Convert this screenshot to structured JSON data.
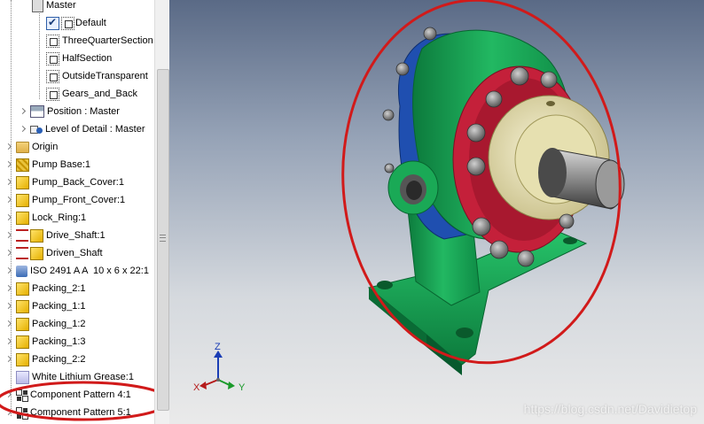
{
  "browser": {
    "items": [
      {
        "label": "Master",
        "icon": "document-icon"
      },
      {
        "label": "Default",
        "icon": "checked-view-icon"
      },
      {
        "label": "ThreeQuarterSection",
        "icon": "view-rep-icon"
      },
      {
        "label": "HalfSection",
        "icon": "view-rep-icon"
      },
      {
        "label": "OutsideTransparent",
        "icon": "view-rep-icon"
      },
      {
        "label": "Gears_and_Back",
        "icon": "view-rep-icon"
      },
      {
        "label": "Position : Master",
        "icon": "position-rep-icon"
      },
      {
        "label": "Level of Detail : Master",
        "icon": "level-of-detail-icon"
      },
      {
        "label": "Origin",
        "icon": "folder-icon"
      },
      {
        "label": "Pump Base:1",
        "icon": "part-icon"
      },
      {
        "label": "Pump_Back_Cover:1",
        "icon": "part-icon"
      },
      {
        "label": "Pump_Front_Cover:1",
        "icon": "part-icon"
      },
      {
        "label": "Lock_Ring:1",
        "icon": "part-icon"
      },
      {
        "label": "Drive_Shaft:1",
        "icon": "part-icon"
      },
      {
        "label": "Driven_Shaft",
        "icon": "part-icon"
      },
      {
        "label": "ISO 2491 A A  10 x 6 x 22:1",
        "icon": "bearing-icon"
      },
      {
        "label": "Packing_2:1",
        "icon": "part-icon"
      },
      {
        "label": "Packing_1:1",
        "icon": "part-icon"
      },
      {
        "label": "Packing_1:2",
        "icon": "part-icon"
      },
      {
        "label": "Packing_1:3",
        "icon": "part-icon"
      },
      {
        "label": "Packing_2:2",
        "icon": "part-icon"
      },
      {
        "label": "White Lithium Grease:1",
        "icon": "grease-icon"
      },
      {
        "label": "Component Pattern 4:1",
        "icon": "pattern-icon"
      },
      {
        "label": "Component Pattern 5:1",
        "icon": "pattern-icon"
      }
    ]
  },
  "viewcube": {
    "x": "X",
    "y": "Y",
    "z": "Z"
  },
  "watermark": "https://blog.csdn.net/Davidietop",
  "colors": {
    "annotation": "#d11a1a",
    "base": "#19a455",
    "back_cover": "#1f4fb0",
    "front_cover": "#c4203a",
    "lock_ring": "#e6e0b0"
  }
}
